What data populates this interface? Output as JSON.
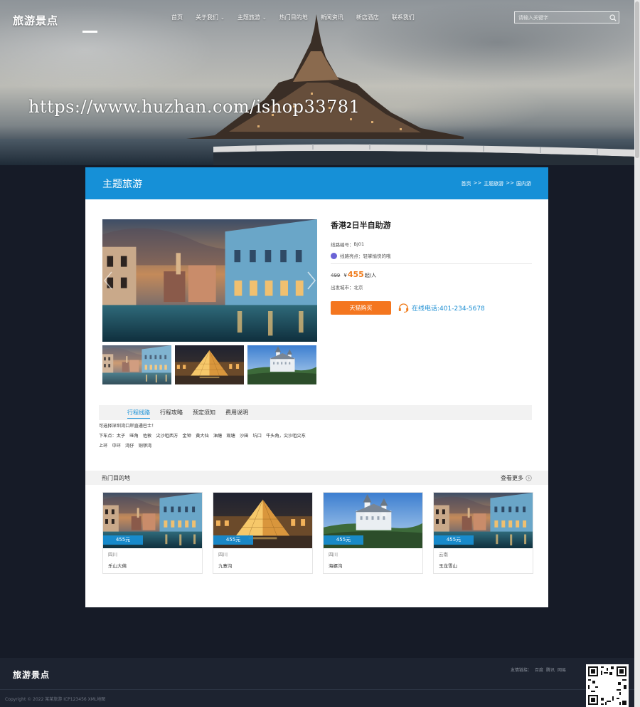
{
  "brand": {
    "logo_text": "旅游景点"
  },
  "nav": {
    "items": [
      {
        "label": "首页",
        "has_caret": false
      },
      {
        "label": "关于我们",
        "has_caret": true
      },
      {
        "label": "主题旅游",
        "has_caret": true
      },
      {
        "label": "热门目的地",
        "has_caret": false
      },
      {
        "label": "新闻资讯",
        "has_caret": false
      },
      {
        "label": "新店酒店",
        "has_caret": false
      },
      {
        "label": "联系我们",
        "has_caret": false
      }
    ]
  },
  "search": {
    "placeholder": "请输入关键字"
  },
  "hero": {
    "watermark": "https://www.huzhan.com/ishop33781"
  },
  "page": {
    "title": "主题旅游",
    "breadcrumb": [
      "首页",
      ">>",
      "主题旅游",
      ">>",
      "国内游"
    ]
  },
  "product": {
    "name": "香港2日半自助游",
    "code_label": "线路编号：",
    "code": "BJ01",
    "highlight_label": "线路亮点：",
    "highlight": "轻掌愉快的哦",
    "old_price": "499",
    "currency": "¥",
    "price": "455",
    "price_unit": "起/人",
    "depart_label": "出发城市：",
    "depart_city": "北京",
    "buy_label": "天猫购买",
    "phone_label": "在线电话:401-234-5678"
  },
  "tabs": [
    {
      "label": "行程线路",
      "active": true
    },
    {
      "label": "行程攻略",
      "active": false
    },
    {
      "label": "预定须知",
      "active": false
    },
    {
      "label": "费用说明",
      "active": false
    }
  ],
  "description": {
    "line1": "可选择深圳湾口岸直通巴士！",
    "line2": "下车点：太子　旺角　佐敦　尖沙咀西方　金钟　黄大仙　油塘　观塘　沙田　坑口　牛头角，尖沙咀尖东",
    "line3": "上环　中环　湾仔　铜锣湾"
  },
  "hot": {
    "title": "热门目的地",
    "more_label": "查看更多",
    "items": [
      {
        "price": "455元",
        "region": "四川",
        "name": "乐山大佛",
        "scene": "venice"
      },
      {
        "price": "455元",
        "region": "四川",
        "name": "九寨沟",
        "scene": "louvre"
      },
      {
        "price": "455元",
        "region": "四川",
        "name": "海螺沟",
        "scene": "castle"
      },
      {
        "price": "455元",
        "region": "云南",
        "name": "玉龙雪山",
        "scene": "venice"
      }
    ]
  },
  "footer": {
    "logo_text": "旅游景点",
    "links_label": "友情链接：",
    "links": [
      "百度",
      "腾讯",
      "网易"
    ],
    "copyright": "Copyright © 2022 某某旅游 ICP123456 XML地图"
  },
  "icons": {
    "search": "search-icon",
    "caret": "chevron-down-icon",
    "highlight": "highlight-dot-icon",
    "phone": "headset-icon",
    "more": "arrow-circle-icon",
    "qr": "qr-code-icon"
  },
  "colors": {
    "accent_blue": "#1690d7",
    "buy_orange": "#f4761f",
    "price_orange": "#f07c1c",
    "footer_bg": "#1d2330"
  }
}
